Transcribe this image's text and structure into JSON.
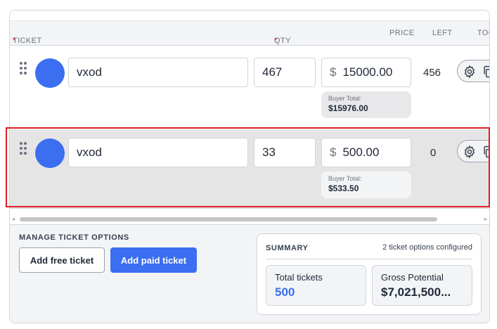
{
  "header": {
    "ticket": "TICKET",
    "qty": "QTY",
    "required_mark": "*",
    "price": "PRICE",
    "left": "LEFT",
    "tools": "TOO"
  },
  "rows": [
    {
      "name": "vxod",
      "qty": "467",
      "currency": "$",
      "price": "15000.00",
      "buyer_total_label": "Buyer Total:",
      "buyer_total": "$15976.00",
      "left": "456"
    },
    {
      "name": "vxod",
      "qty": "33",
      "currency": "$",
      "price": "500.00",
      "buyer_total_label": "Buyer Total:",
      "buyer_total": "$533.50",
      "left": "0"
    }
  ],
  "scrollbar": {
    "left_arrow": "◂",
    "right_arrow": "▸"
  },
  "manage": {
    "title": "MANAGE TICKET OPTIONS",
    "add_free": "Add free ticket",
    "add_paid": "Add paid ticket"
  },
  "summary": {
    "title": "SUMMARY",
    "configured": "2 ticket options configured",
    "total_tickets_label": "Total tickets",
    "total_tickets": "500",
    "gross_label": "Gross Potential",
    "gross": "$7,021,500..."
  },
  "colors": {
    "accent": "#3b6ef0",
    "highlight": "#e11d24",
    "required": "#dc2626"
  }
}
